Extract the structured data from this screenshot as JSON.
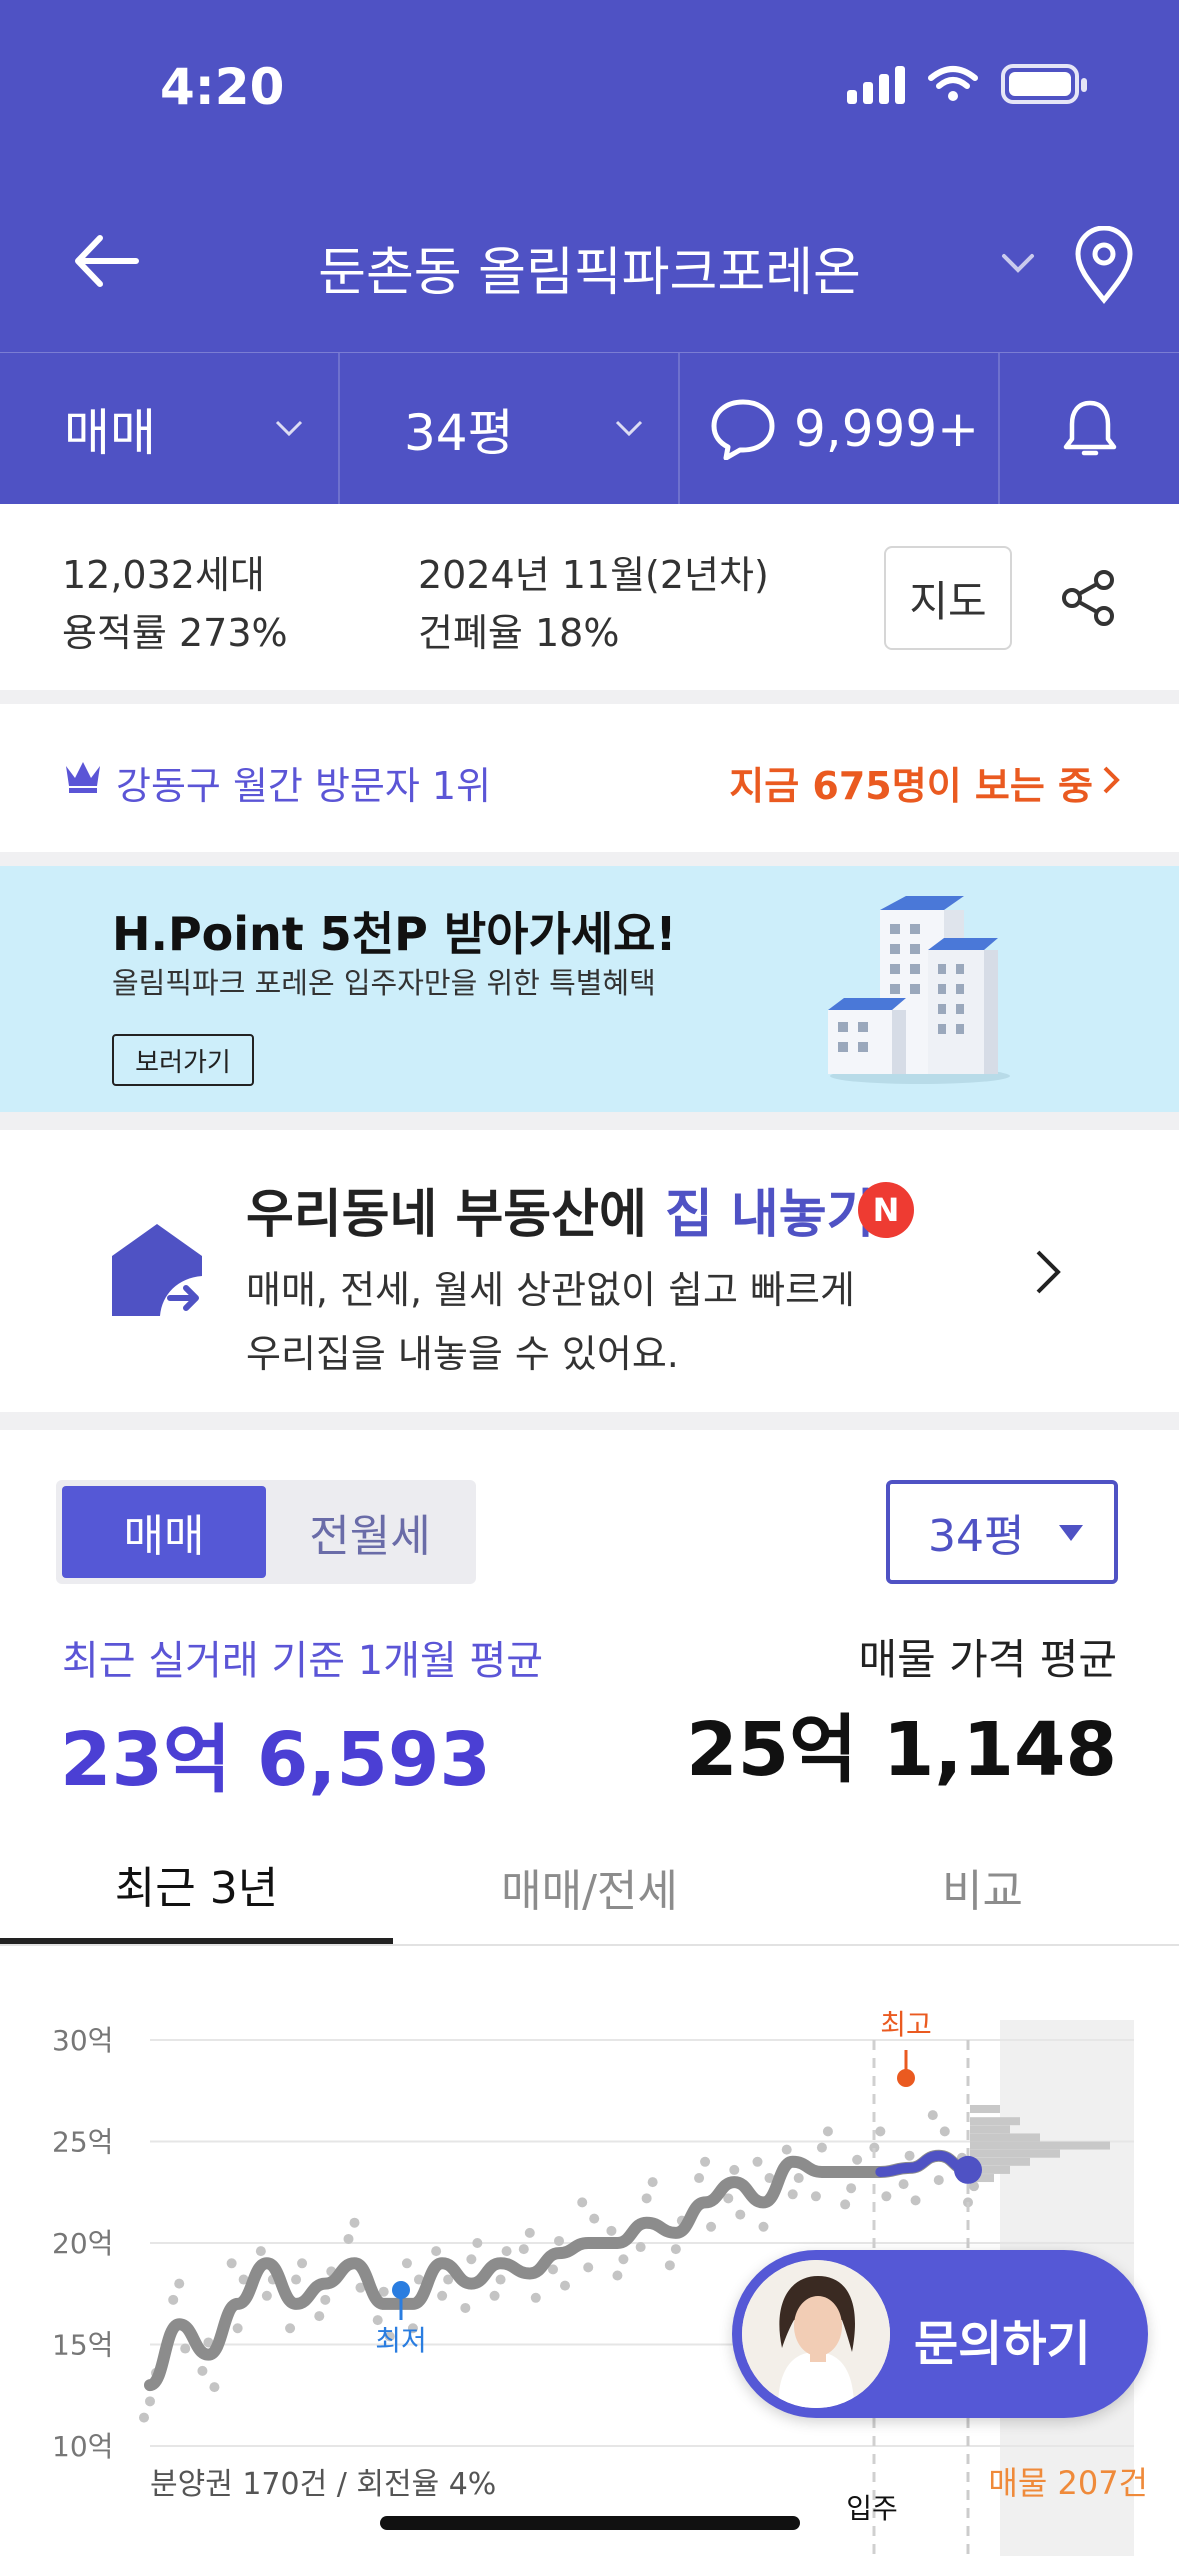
{
  "status_bar": {
    "time": "4:20"
  },
  "header": {
    "title": "둔촌동 올림픽파크포레온",
    "filters": {
      "trade_type": "매매",
      "size": "34평",
      "comment_count": "9,999+"
    }
  },
  "info": {
    "households": "12,032세대",
    "floor_area_ratio": "용적률 273%",
    "move_in": "2024년 11월(2년차)",
    "coverage_ratio": "건폐율 18%",
    "map_button": "지도"
  },
  "visitor": {
    "rank": "강동구 월간 방문자 1위",
    "viewing_now": "지금 675명이 보는 중"
  },
  "banner": {
    "title": "H.Point 5천P 받아가세요!",
    "subtitle": "올림픽파크 포레온 입주자만을 위한 특별혜택",
    "button": "보러가기"
  },
  "list_property": {
    "title_prefix": "우리동네 부동산에 ",
    "title_highlight": "집 내놓기",
    "badge": "N",
    "desc_line1": "매매, 전세, 월세 상관없이 쉽고 빠르게",
    "desc_line2": "우리집을 내놓을 수 있어요."
  },
  "price": {
    "segments": [
      "매매",
      "전월세"
    ],
    "selected_segment": "매매",
    "size_select": "34평",
    "recent_label": "최근 실거래 기준 1개월 평균",
    "recent_value": "23억 6,593",
    "listing_label": "매물 가격 평균",
    "listing_value": "25억 1,148"
  },
  "tabs": [
    "최근 3년",
    "매매/전세",
    "비교"
  ],
  "active_tab": "최근 3년",
  "chart_data": {
    "type": "line",
    "y_ticks": [
      "30억",
      "25억",
      "20억",
      "15억",
      "10억"
    ],
    "ylim": [
      10,
      30
    ],
    "series": [
      {
        "values": [
          13,
          16,
          14.5,
          17,
          19,
          17,
          18,
          19,
          17,
          17,
          19,
          18,
          19,
          18.5,
          19.5,
          20,
          20,
          21,
          20.5,
          22,
          23,
          22,
          24,
          23.5,
          23.5,
          23.5,
          23.7,
          24.3,
          23.6
        ]
      }
    ],
    "annotations": {
      "max_label": "최고",
      "min_label": "최저",
      "footer_left": "분양권 170건 / 회전율 4%",
      "move_in_label": "입주",
      "listing_count": "매물 207건"
    },
    "colors": {
      "line": "#8c8c8c",
      "recent": "#4f52c4",
      "max": "#ea5a20",
      "min": "#2a7de0",
      "listing": "#ef8a3a"
    },
    "grid": true
  },
  "inquiry": {
    "label": "문의하기"
  },
  "colors": {
    "primary": "#4f52c4",
    "accent_orange": "#ea5a20",
    "banner_bg": "#cdeefa"
  }
}
